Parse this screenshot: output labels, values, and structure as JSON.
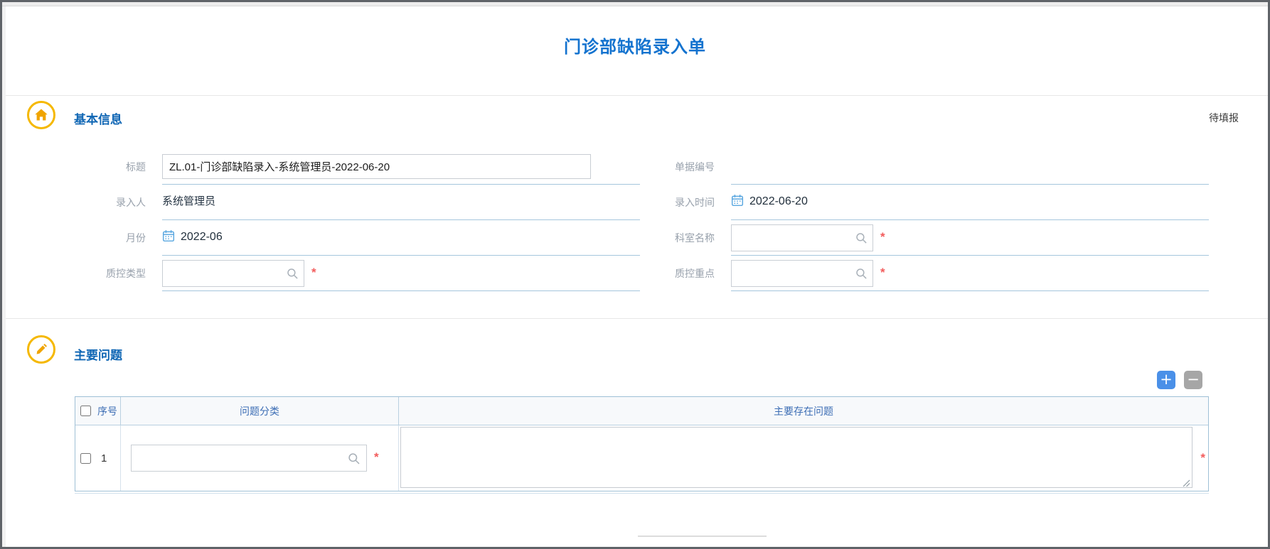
{
  "page": {
    "title": "门诊部缺陷录入单"
  },
  "basic_info": {
    "title": "基本信息",
    "status": "待填报",
    "required_marker": "*",
    "title_field": {
      "label": "标题",
      "value": "ZL.01-门诊部缺陷录入-系统管理员-2022-06-20"
    },
    "doc_no": {
      "label": "单据编号",
      "value": ""
    },
    "entered_by": {
      "label": "录入人",
      "value": "系统管理员"
    },
    "entry_time": {
      "label": "录入时间",
      "value": "2022-06-20"
    },
    "month": {
      "label": "月份",
      "value": "2022-06"
    },
    "dept_name": {
      "label": "科室名称",
      "value": ""
    },
    "qc_type": {
      "label": "质控类型",
      "value": ""
    },
    "qc_focus": {
      "label": "质控重点",
      "value": ""
    }
  },
  "main_problems": {
    "title": "主要问题",
    "add_button": "+",
    "remove_button": "−",
    "required_marker": "*",
    "table": {
      "headers": {
        "index": "序号",
        "category": "问题分类",
        "issues": "主要存在问题"
      },
      "rows": [
        {
          "index": "1",
          "category": "",
          "issues": ""
        }
      ]
    }
  },
  "colors": {
    "accent_blue": "#1473cf",
    "section_blue": "#0f66b4",
    "icon_yellow": "#f5b800",
    "required_red": "#f25c5c",
    "underline_blue": "#a5c6dd",
    "add_button_blue": "#4a90e8",
    "remove_button_gray": "#a6a6a6"
  }
}
